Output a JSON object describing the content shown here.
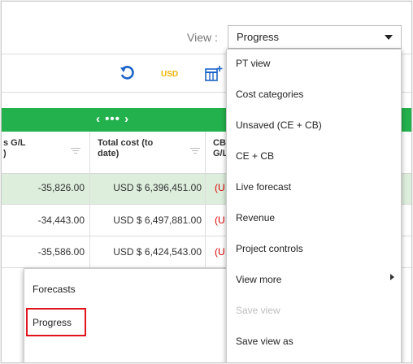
{
  "header": {
    "view_label": "View :",
    "selected_view": "Progress"
  },
  "toolbar": {
    "currency": "USD",
    "undo_icon": "undo-icon",
    "grid_icon": "column-add-icon"
  },
  "table": {
    "pager": "‹ ••• ›",
    "columns": [
      {
        "label": "s G/L\n)"
      },
      {
        "label": "Total cost (to\ndate)"
      },
      {
        "label": "CB\nG/L"
      }
    ],
    "rows": [
      {
        "gl": "-35,826.00",
        "total": "USD $ 6,396,451.00",
        "cb": "(U",
        "highlight": true
      },
      {
        "gl": "-34,443.00",
        "total": "USD $ 6,497,881.00",
        "cb": "(U",
        "highlight": false
      },
      {
        "gl": "-35,586.00",
        "total": "USD $ 6,424,543.00",
        "cb": "(U",
        "highlight": false
      }
    ]
  },
  "view_menu": {
    "items": [
      {
        "label": "PT view",
        "disabled": false
      },
      {
        "label": "Cost categories",
        "disabled": false
      },
      {
        "label": "Unsaved (CE + CB)",
        "disabled": false
      },
      {
        "label": "CE + CB",
        "disabled": false
      },
      {
        "label": "Live forecast",
        "disabled": false
      },
      {
        "label": "Revenue",
        "disabled": false
      },
      {
        "label": "Project controls",
        "disabled": false
      },
      {
        "label": "View more",
        "disabled": false
      },
      {
        "label": "Save view",
        "disabled": true
      },
      {
        "label": "Save view as",
        "disabled": false
      }
    ]
  },
  "submenu": {
    "items": [
      {
        "label": "Forecasts"
      },
      {
        "label": "Progress"
      }
    ]
  },
  "colors": {
    "green_bar": "#23b14d",
    "accent_usd": "#f0b400",
    "highlight_border": "#e0141c"
  }
}
